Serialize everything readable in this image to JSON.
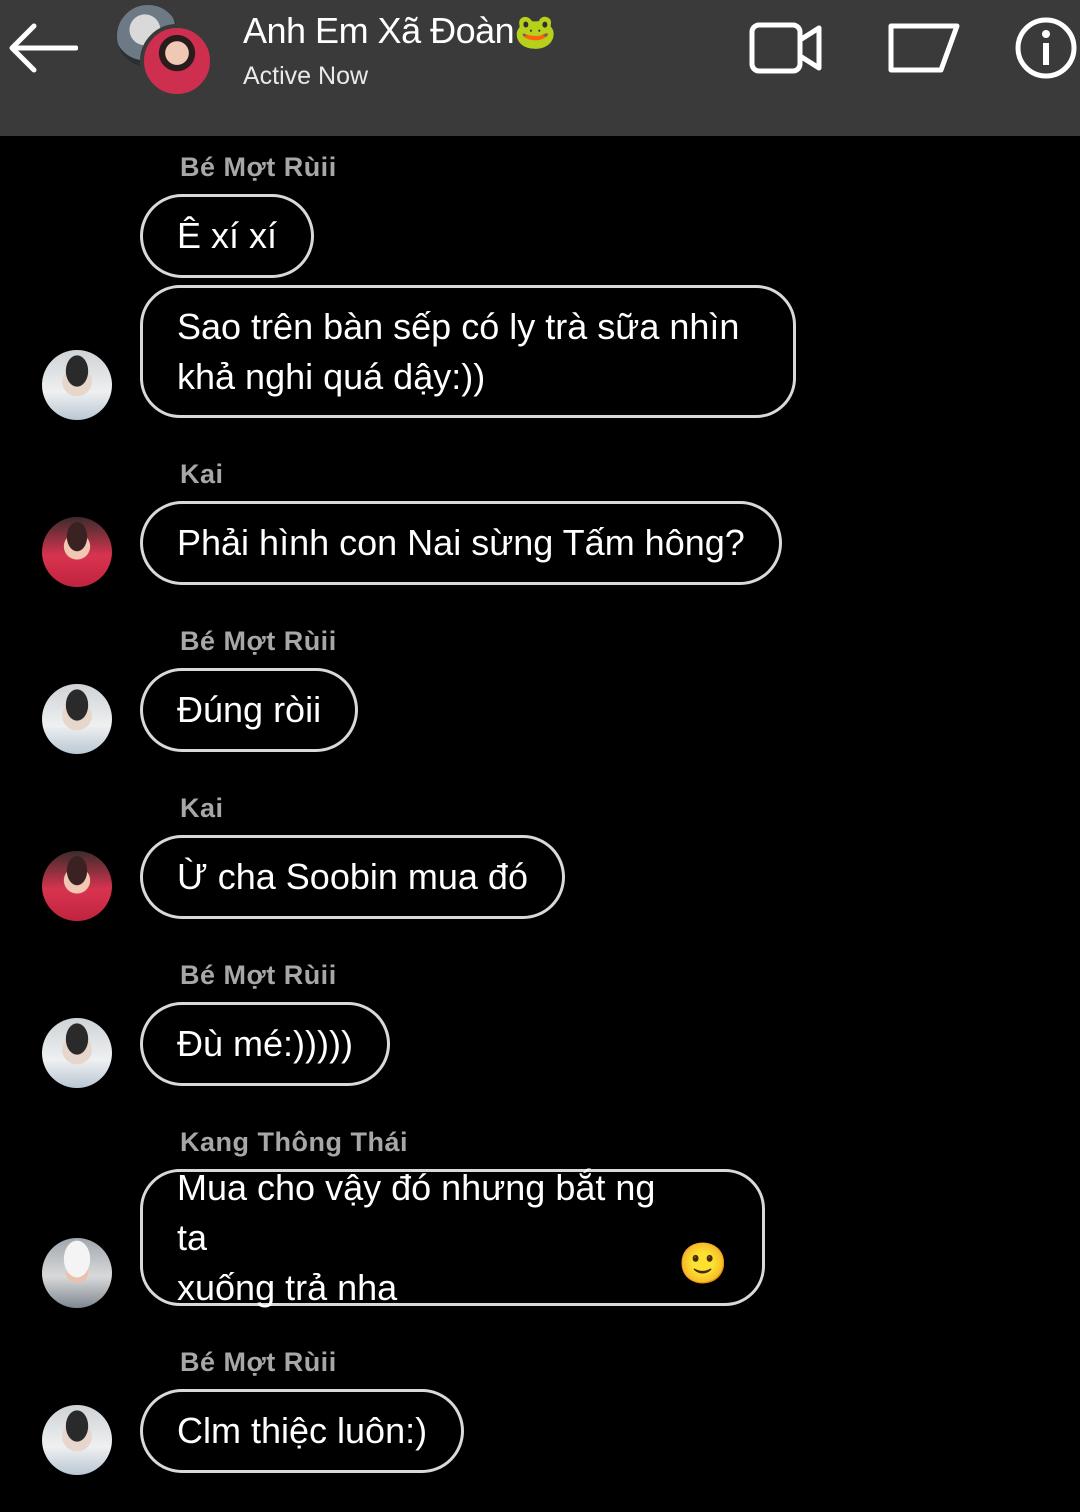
{
  "header": {
    "title": "Anh Em Xã Đoàn",
    "title_emoji": "🐸",
    "status": "Active Now",
    "icons": {
      "back": "back-arrow-icon",
      "video": "video-camera-icon",
      "flag": "flag-icon",
      "info": "info-icon"
    }
  },
  "messages": [
    {
      "sender": "Bé Mợt Rùii",
      "text": "Ê xí xí"
    },
    {
      "sender": "",
      "text": "Sao trên bàn sếp có ly trà sữa nhìn\nkhả nghi quá dậy:))"
    },
    {
      "sender": "Kai",
      "text": "Phải hình con Nai sừng Tấm hông?"
    },
    {
      "sender": "Bé Mợt Rùii",
      "text": "Đúng ròii"
    },
    {
      "sender": "Kai",
      "text": "Ừ cha Soobin mua đó"
    },
    {
      "sender": "Bé Mợt Rùii",
      "text": "Đù mé:)))))"
    },
    {
      "sender": "Kang Thông Thái",
      "text": "Mua cho vậy đó nhưng bắt ng ta\nxuống trả nha",
      "emoji": "🙂"
    },
    {
      "sender": "Bé Mợt Rùii",
      "text": "Clm thiệc luôn:)"
    }
  ],
  "colors": {
    "header_bg": "#3a3a3a",
    "background": "#000000",
    "bubble_border": "#d9d9d9",
    "sender_text": "#a7a7a7"
  }
}
